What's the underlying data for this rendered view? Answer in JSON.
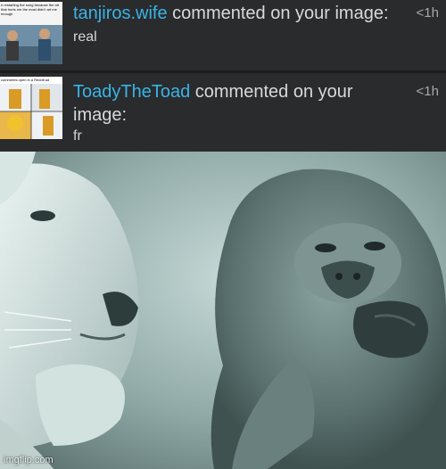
{
  "notifications": [
    {
      "username": "tanjiros.wife",
      "action": "commented on your image:",
      "time": "<1h",
      "comment": "real",
      "thumb_caption": "e restarting the song because the art that hurts me the most didn't art me enough"
    },
    {
      "username": "ToadyTheToad",
      "action": "commented on your image:",
      "time": "<1h",
      "comment": "fr",
      "thumb_caption": "comments open in a Reddit ad"
    }
  ],
  "meme": {
    "watermark": "imgflip.com"
  },
  "colors": {
    "background": "#2a2b2d",
    "username": "#39b4e6",
    "text": "#d9d9d9"
  }
}
